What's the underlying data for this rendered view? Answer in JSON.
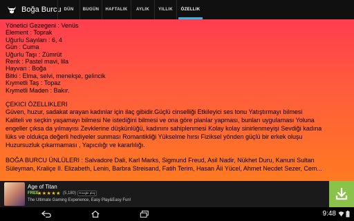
{
  "app": {
    "title": "Boğa Burcu",
    "icon": "bull-icon"
  },
  "tabs": [
    {
      "label": "DÜN",
      "active": false
    },
    {
      "label": "BUGÜN",
      "active": false
    },
    {
      "label": "HAFTALIK",
      "active": false
    },
    {
      "label": "AYLIK",
      "active": false
    },
    {
      "label": "YILLIK",
      "active": false
    },
    {
      "label": "ÖZELLIK",
      "active": true
    }
  ],
  "content": {
    "attributes": [
      "Yönetici Gezegeni : Venüs",
      "Element : Toprak",
      "Uğurlu Sayıları : 6, 4",
      "Gün : Cuma",
      "Uğurlu Taşı : Zümrüt",
      "Renk : Pastel mavi, lila",
      "Hayvan : Boğa",
      "Bitki : Elma, selvi, menekşe, gelincik",
      "Kıymetli Taş : Topaz",
      "Kıymetli Maden : Bakır."
    ],
    "section_title": "ÇEKICI ÖZELLIKLERI",
    "lines": [
      "  Güven, huzur, sadakat arayan kadınlar için ilaç gibidir.Güçlü cinselliği Etkileyici ses tonu Yatıştırmayı bilmesi",
      "Kaliteli ve seçkin yaşamayı bilmesi Ne istediğini bilmesi ve ona göre planlar yapması, bunları uygulaması Yoluna",
      "engeller çıksa da yılmayısı Zevklerine düşkünlüğü, kadınını sahiplenmesi Kolay kolay sinirlenmeyişi Sevdiği kadına",
      "lüks ve oldukça değerli hediyeler sunması Romantikliği Yükselme hırsı Fiziksel yönden güçlü bir erkek oluşu",
      "Huzursuzluk çıkarmaması , Yapıcılığı ve kararlılığı."
    ],
    "famous_lines": [
      "BOĞA BURCU ÜNLÜLERI : Salvadore Dali, Karl Marks, Sigmund Freud, Asil Nadir, Nükhet Duru, Kanuni Sultan",
      "Süleyman, Kraliçe II. Elizabeth, Lenin, Barbra Streisand, Fatih Terim, Hasan Âli Yücel, Ahmet Necdet Sezer, Cem..."
    ]
  },
  "ad": {
    "title": "Age of Titan",
    "free_label": "FREE",
    "stars": "★★★★★",
    "rating_count": "(5,180)",
    "store_badge": "Google play",
    "description": "The Ultimate Gaming Experience, Easy Play&Easy Fun!",
    "action_icon": "download-icon",
    "accent": "#8bc34a"
  },
  "system": {
    "clock": "9:48",
    "nav_icons": [
      "back-icon",
      "home-icon",
      "recent-apps-icon"
    ]
  },
  "colors": {
    "content_top": "#ff3d50",
    "content_bottom": "#ff7a22",
    "tab_indicator": "#33b5e5"
  }
}
